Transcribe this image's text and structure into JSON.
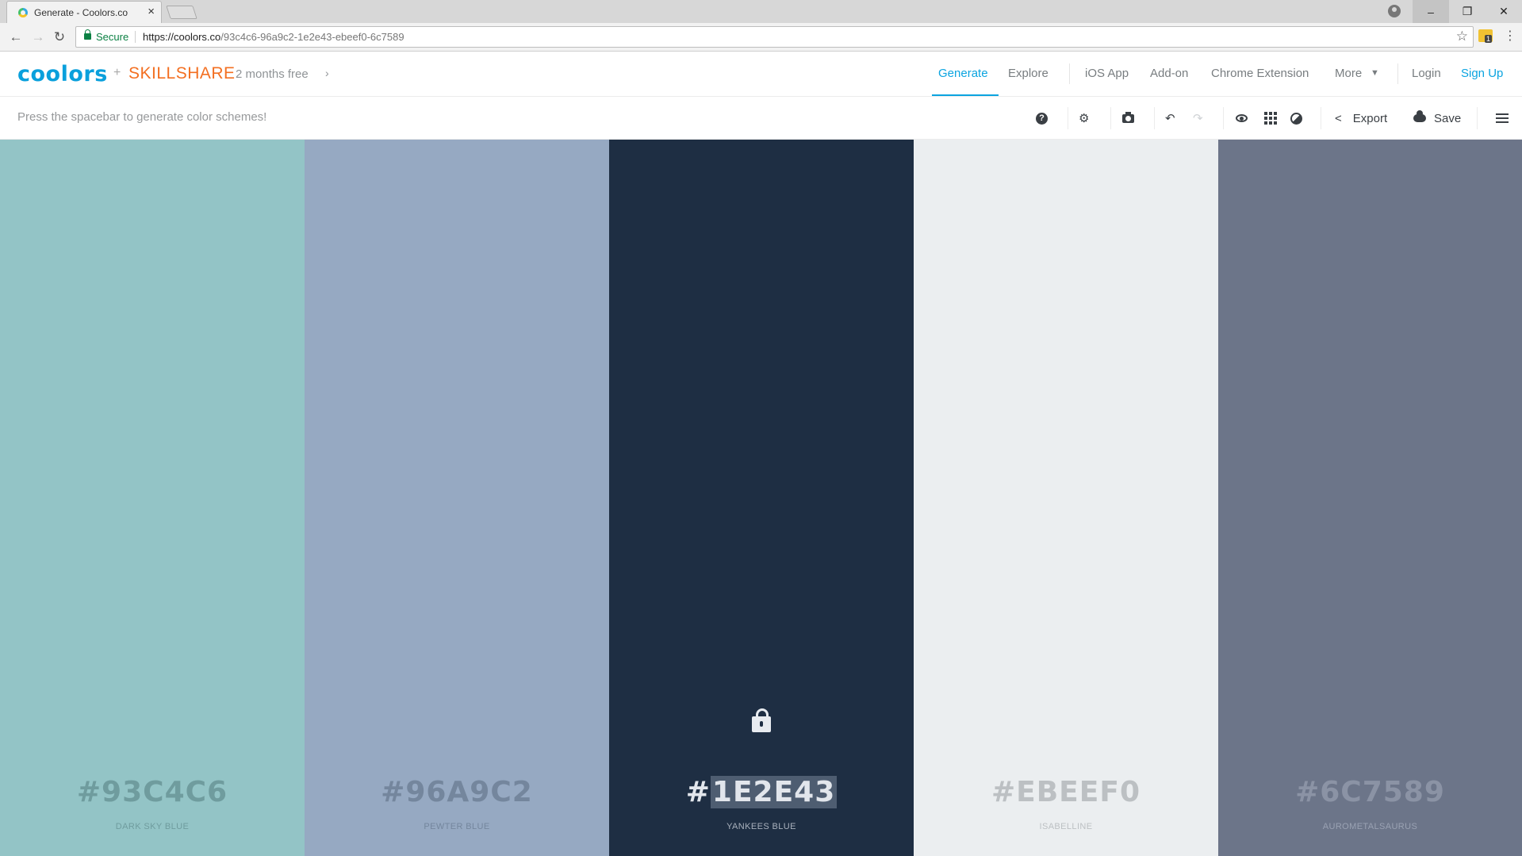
{
  "browser": {
    "tab_title": "Generate - Coolors.co",
    "secure_label": "Secure",
    "url_host": "https://coolors.co",
    "url_path": "/93c4c6-96a9c2-1e2e43-ebeef0-6c7589",
    "extension_badge": "1"
  },
  "header": {
    "logo": "coolors",
    "plus": "+",
    "partner": "SKILLSHARE",
    "promo": "2 months free",
    "nav": {
      "generate": "Generate",
      "explore": "Explore",
      "ios_app": "iOS App",
      "addon": "Add-on",
      "chrome_extension": "Chrome Extension",
      "more": "More",
      "login": "Login",
      "signup": "Sign Up"
    },
    "accent_color": "#0ba4e0"
  },
  "toolbar": {
    "hint": "Press the spacebar to generate color schemes!",
    "help_glyph": "?",
    "export_label": "Export",
    "save_label": "Save"
  },
  "palette": [
    {
      "hex": "#93C4C6",
      "name": "DARK SKY BLUE",
      "bg": "#93c4c6",
      "text": "#6f9c9e",
      "label": "#6f9c9e",
      "locked": false
    },
    {
      "hex": "#96A9C2",
      "name": "PEWTER BLUE",
      "bg": "#96a9c2",
      "text": "#74869d",
      "label": "#74869d",
      "locked": false
    },
    {
      "hex": "#1E2E43",
      "name": "YANKEES BLUE",
      "bg": "#1e2e43",
      "text": "#e2e6ec",
      "label": "#a9b1bd",
      "locked": true,
      "hex_prefix": "#",
      "hex_selected": "1E2E43"
    },
    {
      "hex": "#EBEEF0",
      "name": "ISABELLINE",
      "bg": "#ebeef0",
      "text": "#bcc0c3",
      "label": "#bcc0c3",
      "locked": false
    },
    {
      "hex": "#6C7589",
      "name": "AUROMETALSAURUS",
      "bg": "#6c7589",
      "text": "#8b93a5",
      "label": "#9aa2b3",
      "locked": false
    }
  ]
}
